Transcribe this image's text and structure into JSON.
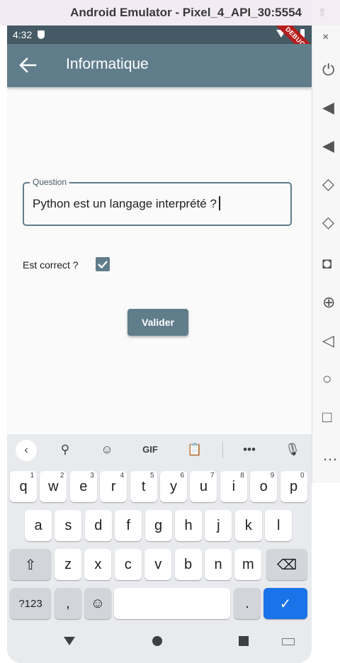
{
  "window": {
    "title": "Android Emulator - Pixel_4_API_30:5554"
  },
  "status_bar": {
    "time": "4:32",
    "debug_banner": "DEBUG"
  },
  "app_bar": {
    "title": "Informatique"
  },
  "form": {
    "question_label": "Question",
    "question_value": "Python est un langage interprété ?",
    "correct_label": "Est correct ?",
    "correct_checked": true,
    "submit_label": "Valider"
  },
  "keyboard": {
    "toolbar": [
      "collapse-icon",
      "search-icon",
      "sticker-icon",
      "GIF",
      "clipboard-icon",
      "more-icon",
      "mic-icon"
    ],
    "gif_label": "GIF",
    "more_label": "•••",
    "row1": [
      {
        "k": "q",
        "h": "1"
      },
      {
        "k": "w",
        "h": "2"
      },
      {
        "k": "e",
        "h": "3"
      },
      {
        "k": "r",
        "h": "4"
      },
      {
        "k": "t",
        "h": "5"
      },
      {
        "k": "y",
        "h": "6"
      },
      {
        "k": "u",
        "h": "7"
      },
      {
        "k": "i",
        "h": "8"
      },
      {
        "k": "o",
        "h": "9"
      },
      {
        "k": "p",
        "h": "0"
      }
    ],
    "row2": [
      "a",
      "s",
      "d",
      "f",
      "g",
      "h",
      "j",
      "k",
      "l"
    ],
    "row3": [
      "z",
      "x",
      "c",
      "v",
      "b",
      "n",
      "m"
    ],
    "symbols_label": "?123",
    "comma_label": ",",
    "period_label": ".",
    "colors": {
      "enter": "#1a73e8",
      "key": "#ffffff",
      "func_key": "#d3d5da",
      "background": "#e8eaed"
    }
  },
  "colors": {
    "primary": "#607d8b",
    "status_bar": "#455a64",
    "debug": "#b71c1c"
  },
  "side_panel": {
    "tools": [
      "close-icon",
      "power-icon",
      "volume-up-icon",
      "volume-down-icon",
      "rotate-left-icon",
      "rotate-right-icon",
      "camera-icon",
      "zoom-icon",
      "back-icon",
      "home-icon",
      "overview-icon",
      "more-icon"
    ]
  }
}
